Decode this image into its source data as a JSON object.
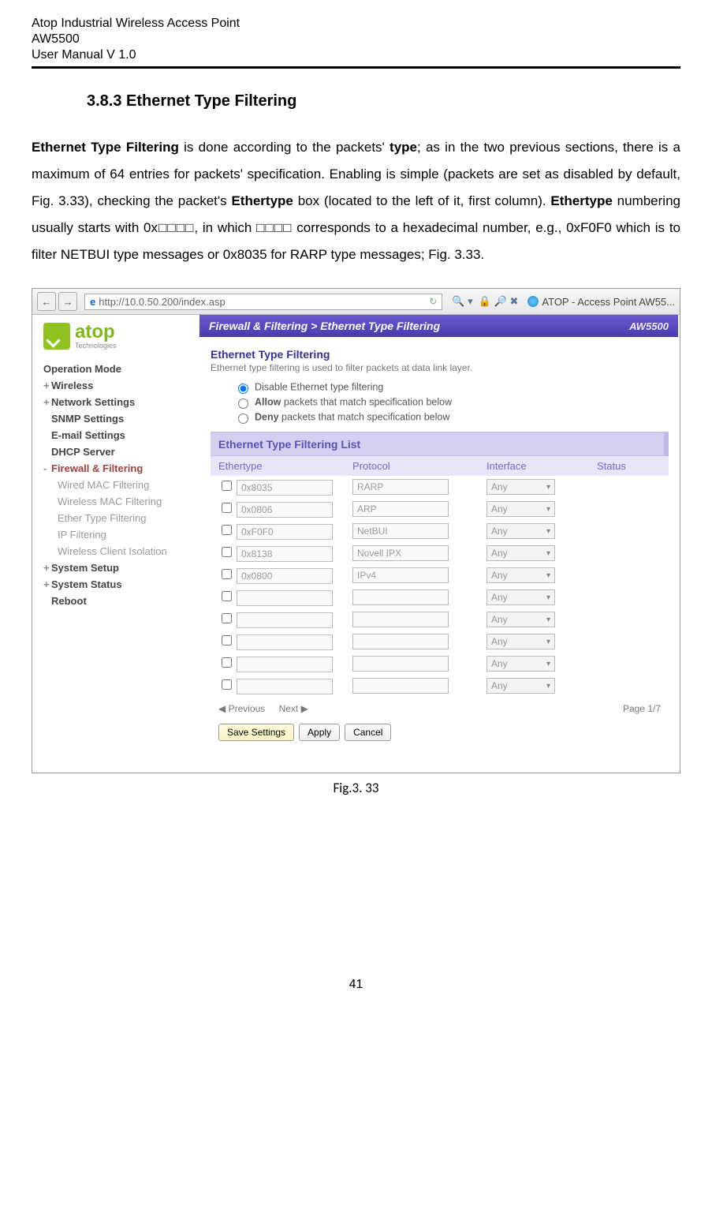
{
  "header": {
    "line1": "Atop Industrial Wireless Access Point",
    "line2": "AW5500",
    "line3": "User Manual V 1.0"
  },
  "section_title": "3.8.3 Ethernet Type Filtering",
  "body": {
    "p1a": "Ethernet Type Filtering",
    "p1b": " is done according to the packets' ",
    "p1c": "type",
    "p1d": "; as in the two previous sections, there is a maximum of 64 entries for packets' specification. Enabling is simple (packets are set as disabled by default, Fig. 3.33), checking the packet's ",
    "p1e": "Ethertype",
    "p1f": " box (located to the left of it, first column). ",
    "p1g": "Ethertype",
    "p1h": " numbering usually starts with 0x□□□□, in which □□□□ corresponds to a hexadecimal number, e.g., 0xF0F0 which is to filter NETBUI type messages or 0x8035 for RARP type messages; Fig. 3.33."
  },
  "fig_caption": "Fig.3. 33",
  "page_number": "41",
  "browser": {
    "url": "http://10.0.50.200/index.asp",
    "tab": "ATOP - Access Point AW55..."
  },
  "logo": {
    "name": "atop",
    "sub": "Technologies"
  },
  "nav": {
    "opmode": "Operation Mode",
    "wireless": "Wireless",
    "network": "Network Settings",
    "snmp": "SNMP Settings",
    "email": "E-mail Settings",
    "dhcp": "DHCP Server",
    "firewall": "Firewall & Filtering",
    "sub1": "Wired MAC Filtering",
    "sub2": "Wireless MAC Filtering",
    "sub3": "Ether Type Filtering",
    "sub4": "IP Filtering",
    "sub5": "Wireless Client Isolation",
    "setup": "System Setup",
    "status": "System Status",
    "reboot": "Reboot"
  },
  "crumb": {
    "path": "Firewall & Filtering > Ethernet Type Filtering",
    "model": "AW5500"
  },
  "panel": {
    "title": "Ethernet Type Filtering",
    "desc": "Ethernet type filtering is used to filter packets at data link layer.",
    "r1": "Disable Ethernet type filtering",
    "r2a": "Allow",
    "r2b": " packets that match specification below",
    "r3a": "Deny",
    "r3b": " packets that match specification below"
  },
  "table": {
    "list_title": "Ethernet Type Filtering List",
    "h1": "Ethertype",
    "h2": "Protocol",
    "h3": "Interface",
    "h4": "Status",
    "any": "Any",
    "rows": [
      {
        "et": "0x8035",
        "pr": "RARP"
      },
      {
        "et": "0x0806",
        "pr": "ARP"
      },
      {
        "et": "0xF0F0",
        "pr": "NetBUI"
      },
      {
        "et": "0x8138",
        "pr": "Novell IPX"
      },
      {
        "et": "0x0800",
        "pr": "IPv4"
      },
      {
        "et": "",
        "pr": ""
      },
      {
        "et": "",
        "pr": ""
      },
      {
        "et": "",
        "pr": ""
      },
      {
        "et": "",
        "pr": ""
      },
      {
        "et": "",
        "pr": ""
      }
    ],
    "prev": "◀ Previous",
    "next": "Next ▶",
    "page": "Page 1/7"
  },
  "buttons": {
    "save": "Save Settings",
    "apply": "Apply",
    "cancel": "Cancel"
  }
}
